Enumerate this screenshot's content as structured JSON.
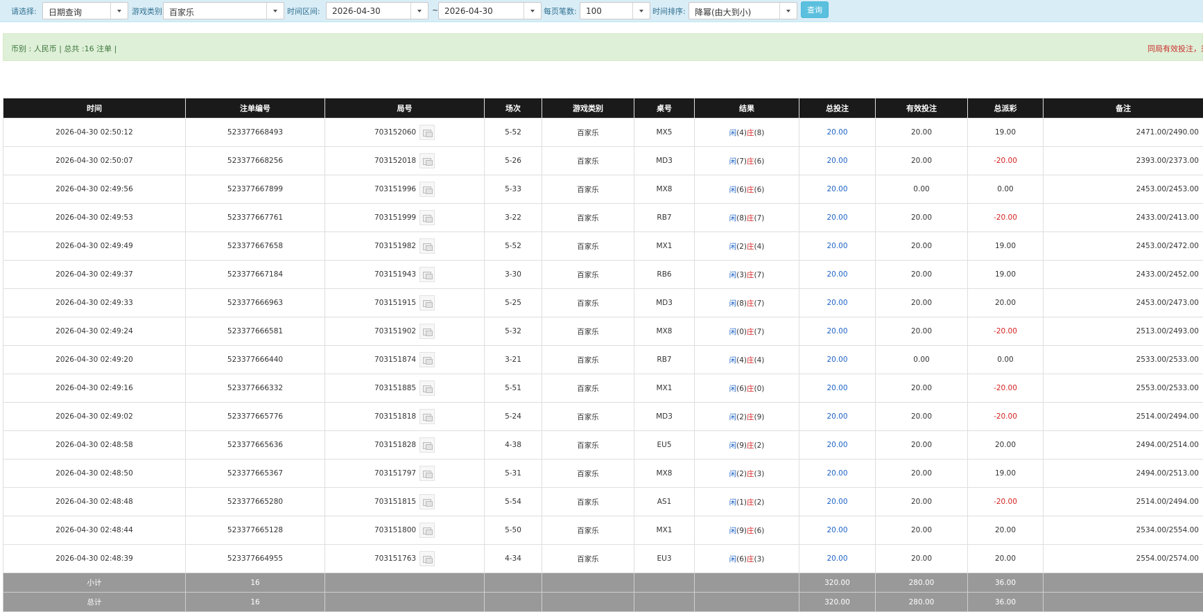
{
  "filters": {
    "select_label": "请选择:",
    "select_value": "日期查询",
    "game_type_label": "游戏类别",
    "game_type_value": "百家乐",
    "time_range_label": "时间区间:",
    "date_from": "2026-04-30",
    "range_sep": "~",
    "date_to": "2026-04-30",
    "page_size_label": "每页笔数:",
    "page_size_value": "100",
    "sort_label": "时间排序:",
    "sort_value": "降幂(由大到小)",
    "query_button": "查询"
  },
  "info": {
    "summary": "币别 : 人民币 | 总共 :16 注单 |",
    "notice": "同局有效投注，须"
  },
  "table": {
    "headers": [
      "时间",
      "注单编号",
      "局号",
      "场次",
      "游戏类别",
      "桌号",
      "结果",
      "总投注",
      "有效投注",
      "总派彩",
      "备注"
    ],
    "rows": [
      {
        "time": "2026-04-30 02:50:12",
        "bet_id": "523377668493",
        "round": "703152060",
        "session": "5-52",
        "game": "百家乐",
        "table": "MX5",
        "p_label": "闲",
        "p": "(4)",
        "b_label": "庄",
        "b": "(8)",
        "total": "20.00",
        "valid": "20.00",
        "payout": "19.00",
        "payout_neg": false,
        "note": "2471.00/2490.00"
      },
      {
        "time": "2026-04-30 02:50:07",
        "bet_id": "523377668256",
        "round": "703152018",
        "session": "5-26",
        "game": "百家乐",
        "table": "MD3",
        "p_label": "闲",
        "p": "(7)",
        "b_label": "庄",
        "b": "(6)",
        "total": "20.00",
        "valid": "20.00",
        "payout": "-20.00",
        "payout_neg": true,
        "note": "2393.00/2373.00"
      },
      {
        "time": "2026-04-30 02:49:56",
        "bet_id": "523377667899",
        "round": "703151996",
        "session": "5-33",
        "game": "百家乐",
        "table": "MX8",
        "p_label": "闲",
        "p": "(6)",
        "b_label": "庄",
        "b": "(6)",
        "total": "20.00",
        "valid": "0.00",
        "payout": "0.00",
        "payout_neg": false,
        "note": "2453.00/2453.00"
      },
      {
        "time": "2026-04-30 02:49:53",
        "bet_id": "523377667761",
        "round": "703151999",
        "session": "3-22",
        "game": "百家乐",
        "table": "RB7",
        "p_label": "闲",
        "p": "(8)",
        "b_label": "庄",
        "b": "(7)",
        "total": "20.00",
        "valid": "20.00",
        "payout": "-20.00",
        "payout_neg": true,
        "note": "2433.00/2413.00"
      },
      {
        "time": "2026-04-30 02:49:49",
        "bet_id": "523377667658",
        "round": "703151982",
        "session": "5-52",
        "game": "百家乐",
        "table": "MX1",
        "p_label": "闲",
        "p": "(2)",
        "b_label": "庄",
        "b": "(4)",
        "total": "20.00",
        "valid": "20.00",
        "payout": "19.00",
        "payout_neg": false,
        "note": "2453.00/2472.00"
      },
      {
        "time": "2026-04-30 02:49:37",
        "bet_id": "523377667184",
        "round": "703151943",
        "session": "3-30",
        "game": "百家乐",
        "table": "RB6",
        "p_label": "闲",
        "p": "(3)",
        "b_label": "庄",
        "b": "(7)",
        "total": "20.00",
        "valid": "20.00",
        "payout": "19.00",
        "payout_neg": false,
        "note": "2433.00/2452.00"
      },
      {
        "time": "2026-04-30 02:49:33",
        "bet_id": "523377666963",
        "round": "703151915",
        "session": "5-25",
        "game": "百家乐",
        "table": "MD3",
        "p_label": "闲",
        "p": "(8)",
        "b_label": "庄",
        "b": "(7)",
        "total": "20.00",
        "valid": "20.00",
        "payout": "20.00",
        "payout_neg": false,
        "note": "2453.00/2473.00"
      },
      {
        "time": "2026-04-30 02:49:24",
        "bet_id": "523377666581",
        "round": "703151902",
        "session": "5-32",
        "game": "百家乐",
        "table": "MX8",
        "p_label": "闲",
        "p": "(0)",
        "b_label": "庄",
        "b": "(7)",
        "total": "20.00",
        "valid": "20.00",
        "payout": "-20.00",
        "payout_neg": true,
        "note": "2513.00/2493.00"
      },
      {
        "time": "2026-04-30 02:49:20",
        "bet_id": "523377666440",
        "round": "703151874",
        "session": "3-21",
        "game": "百家乐",
        "table": "RB7",
        "p_label": "闲",
        "p": "(4)",
        "b_label": "庄",
        "b": "(4)",
        "total": "20.00",
        "valid": "0.00",
        "payout": "0.00",
        "payout_neg": false,
        "note": "2533.00/2533.00"
      },
      {
        "time": "2026-04-30 02:49:16",
        "bet_id": "523377666332",
        "round": "703151885",
        "session": "5-51",
        "game": "百家乐",
        "table": "MX1",
        "p_label": "闲",
        "p": "(6)",
        "b_label": "庄",
        "b": "(0)",
        "total": "20.00",
        "valid": "20.00",
        "payout": "-20.00",
        "payout_neg": true,
        "note": "2553.00/2533.00"
      },
      {
        "time": "2026-04-30 02:49:02",
        "bet_id": "523377665776",
        "round": "703151818",
        "session": "5-24",
        "game": "百家乐",
        "table": "MD3",
        "p_label": "闲",
        "p": "(2)",
        "b_label": "庄",
        "b": "(9)",
        "total": "20.00",
        "valid": "20.00",
        "payout": "-20.00",
        "payout_neg": true,
        "note": "2514.00/2494.00"
      },
      {
        "time": "2026-04-30 02:48:58",
        "bet_id": "523377665636",
        "round": "703151828",
        "session": "4-38",
        "game": "百家乐",
        "table": "EU5",
        "p_label": "闲",
        "p": "(9)",
        "b_label": "庄",
        "b": "(2)",
        "total": "20.00",
        "valid": "20.00",
        "payout": "20.00",
        "payout_neg": false,
        "note": "2494.00/2514.00"
      },
      {
        "time": "2026-04-30 02:48:50",
        "bet_id": "523377665367",
        "round": "703151797",
        "session": "5-31",
        "game": "百家乐",
        "table": "MX8",
        "p_label": "闲",
        "p": "(2)",
        "b_label": "庄",
        "b": "(3)",
        "total": "20.00",
        "valid": "20.00",
        "payout": "19.00",
        "payout_neg": false,
        "note": "2494.00/2513.00"
      },
      {
        "time": "2026-04-30 02:48:48",
        "bet_id": "523377665280",
        "round": "703151815",
        "session": "5-54",
        "game": "百家乐",
        "table": "AS1",
        "p_label": "闲",
        "p": "(1)",
        "b_label": "庄",
        "b": "(2)",
        "total": "20.00",
        "valid": "20.00",
        "payout": "-20.00",
        "payout_neg": true,
        "note": "2514.00/2494.00"
      },
      {
        "time": "2026-04-30 02:48:44",
        "bet_id": "523377665128",
        "round": "703151800",
        "session": "5-50",
        "game": "百家乐",
        "table": "MX1",
        "p_label": "闲",
        "p": "(9)",
        "b_label": "庄",
        "b": "(6)",
        "total": "20.00",
        "valid": "20.00",
        "payout": "20.00",
        "payout_neg": false,
        "note": "2534.00/2554.00"
      },
      {
        "time": "2026-04-30 02:48:39",
        "bet_id": "523377664955",
        "round": "703151763",
        "session": "4-34",
        "game": "百家乐",
        "table": "EU3",
        "p_label": "闲",
        "p": "(6)",
        "b_label": "庄",
        "b": "(3)",
        "total": "20.00",
        "valid": "20.00",
        "payout": "20.00",
        "payout_neg": false,
        "note": "2554.00/2574.00"
      }
    ],
    "subtotal": {
      "label": "小计",
      "count": "16",
      "total": "320.00",
      "valid": "280.00",
      "payout": "36.00"
    },
    "grandtotal": {
      "label": "总计",
      "count": "16",
      "total": "320.00",
      "valid": "280.00",
      "payout": "36.00"
    }
  },
  "colors": {
    "filter_bg": "#d9edf7",
    "info_bg": "#dff0d8",
    "header_bg": "#1a1a1a",
    "sum_bg": "#999999",
    "player_blue": "#1e63c4",
    "banker_red": "#d42020",
    "query_button": "#5bc0de"
  }
}
